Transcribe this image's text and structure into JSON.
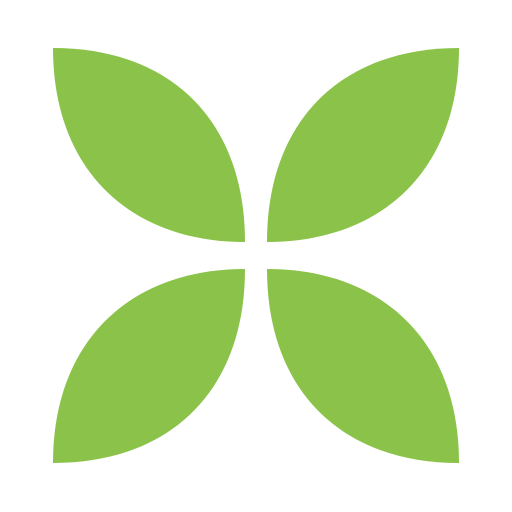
{
  "logo": {
    "icon": "four-leaf-logo-icon",
    "leaf_color": "#8bc34a",
    "background_color": "#ffffff",
    "leaf_count": 4
  }
}
